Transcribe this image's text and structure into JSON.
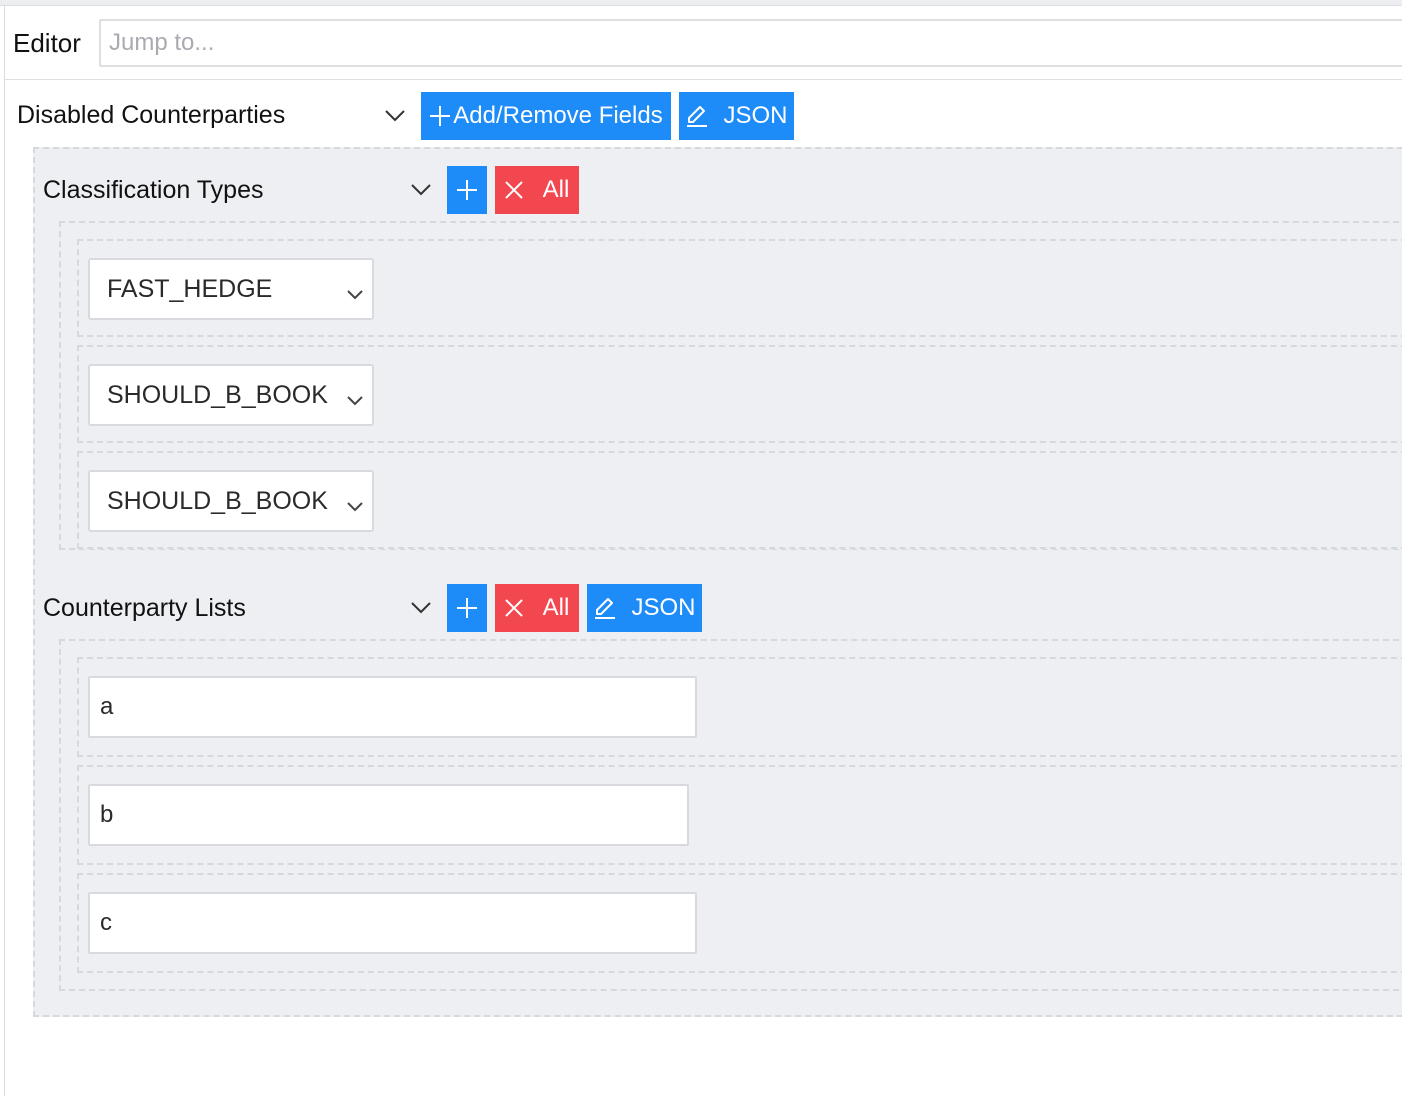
{
  "editor": {
    "label": "Editor",
    "jump_placeholder": "Jump to..."
  },
  "root_section": {
    "title": "Disabled Counterparties",
    "chevron_icon": "chevron-down-icon",
    "add_remove_label": "Add/Remove Fields",
    "json_label": "JSON"
  },
  "classification_types": {
    "title": "Classification Types",
    "remove_all_label": "All",
    "items": [
      {
        "value": "FAST_HEDGE"
      },
      {
        "value": "SHOULD_B_BOOK"
      },
      {
        "value": "SHOULD_B_BOOK"
      }
    ]
  },
  "counterparty_lists": {
    "title": "Counterparty Lists",
    "remove_all_label": "All",
    "json_label": "JSON",
    "items": [
      {
        "value": "a"
      },
      {
        "value": "b"
      },
      {
        "value": "c"
      }
    ]
  },
  "colors": {
    "primary_button": "#1d8bf8",
    "danger_button": "#f3474f",
    "panel_bg": "#eeeff2",
    "dashed_border": "#d5d8dd"
  }
}
